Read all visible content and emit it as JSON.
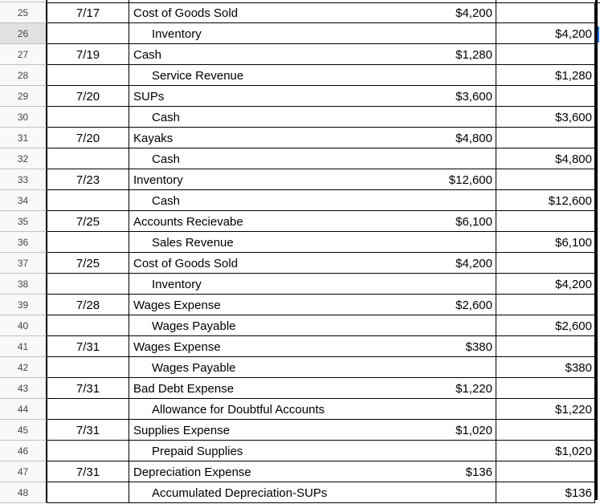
{
  "selected_row": "26",
  "rows": [
    {
      "n": "25",
      "date": "7/17",
      "account": "Cost of Goods Sold",
      "indent": false,
      "debit": "$4,200",
      "credit": ""
    },
    {
      "n": "26",
      "date": "",
      "account": "Inventory",
      "indent": true,
      "debit": "",
      "credit": "$4,200"
    },
    {
      "n": "27",
      "date": "7/19",
      "account": "Cash",
      "indent": false,
      "debit": "$1,280",
      "credit": ""
    },
    {
      "n": "28",
      "date": "",
      "account": "Service Revenue",
      "indent": true,
      "debit": "",
      "credit": "$1,280"
    },
    {
      "n": "29",
      "date": "7/20",
      "account": "SUPs",
      "indent": false,
      "debit": "$3,600",
      "credit": ""
    },
    {
      "n": "30",
      "date": "",
      "account": "Cash",
      "indent": true,
      "debit": "",
      "credit": "$3,600"
    },
    {
      "n": "31",
      "date": "7/20",
      "account": "Kayaks",
      "indent": false,
      "debit": "$4,800",
      "credit": ""
    },
    {
      "n": "32",
      "date": "",
      "account": "Cash",
      "indent": true,
      "debit": "",
      "credit": "$4,800"
    },
    {
      "n": "33",
      "date": "7/23",
      "account": "Inventory",
      "indent": false,
      "debit": "$12,600",
      "credit": ""
    },
    {
      "n": "34",
      "date": "",
      "account": "Cash",
      "indent": true,
      "debit": "",
      "credit": "$12,600"
    },
    {
      "n": "35",
      "date": "7/25",
      "account": "Accounts Recievabe",
      "indent": false,
      "debit": "$6,100",
      "credit": ""
    },
    {
      "n": "36",
      "date": "",
      "account": "Sales Revenue",
      "indent": true,
      "debit": "",
      "credit": "$6,100"
    },
    {
      "n": "37",
      "date": "7/25",
      "account": "Cost of Goods Sold",
      "indent": false,
      "debit": "$4,200",
      "credit": ""
    },
    {
      "n": "38",
      "date": "",
      "account": "Inventory",
      "indent": true,
      "debit": "",
      "credit": "$4,200"
    },
    {
      "n": "39",
      "date": "7/28",
      "account": "Wages Expense",
      "indent": false,
      "debit": "$2,600",
      "credit": ""
    },
    {
      "n": "40",
      "date": "",
      "account": "Wages Payable",
      "indent": true,
      "debit": "",
      "credit": "$2,600"
    },
    {
      "n": "41",
      "date": "7/31",
      "account": "Wages Expense",
      "indent": false,
      "debit": "$380",
      "credit": ""
    },
    {
      "n": "42",
      "date": "",
      "account": "Wages Payable",
      "indent": true,
      "debit": "",
      "credit": "$380"
    },
    {
      "n": "43",
      "date": "7/31",
      "account": "Bad Debt Expense",
      "indent": false,
      "debit": "$1,220",
      "credit": ""
    },
    {
      "n": "44",
      "date": "",
      "account": "Allowance for Doubtful Accounts",
      "indent": true,
      "debit": "",
      "credit": "$1,220"
    },
    {
      "n": "45",
      "date": "7/31",
      "account": "Supplies Expense",
      "indent": false,
      "debit": "$1,020",
      "credit": ""
    },
    {
      "n": "46",
      "date": "",
      "account": "Prepaid Supplies",
      "indent": true,
      "debit": "",
      "credit": "$1,020"
    },
    {
      "n": "47",
      "date": "7/31",
      "account": "Depreciation Expense",
      "indent": false,
      "debit": "$136",
      "credit": ""
    },
    {
      "n": "48",
      "date": "",
      "account": "Accumulated Depreciation-SUPs",
      "indent": true,
      "debit": "",
      "credit": "$136"
    }
  ]
}
